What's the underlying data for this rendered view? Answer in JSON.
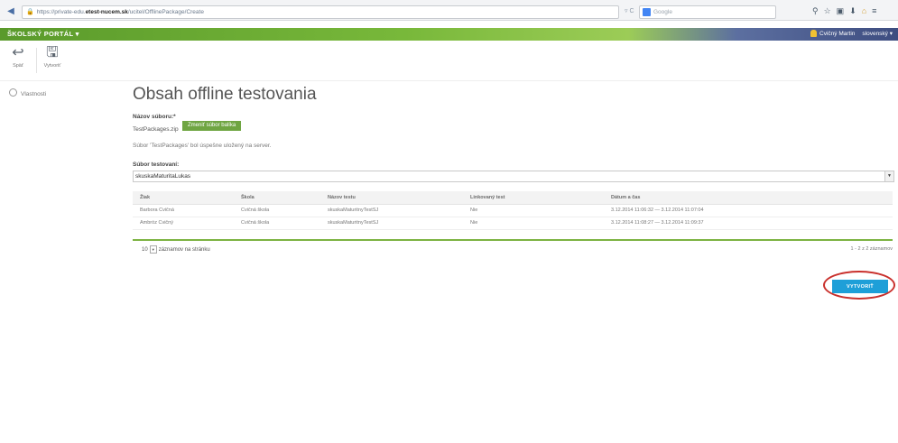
{
  "browser": {
    "url_prefix": "https://private-edu.",
    "url_domain": "etest-nucem.sk",
    "url_path": "/ucitel/OfflinePackage/Create",
    "search_placeholder": "Google",
    "reload_glyph": "▿ C"
  },
  "portal": {
    "title": "ŠKOLSKÝ PORTÁL ▾",
    "user_name": "Cvičný Martin",
    "language": "slovenský ▾"
  },
  "toolbar": {
    "back_label": "Späť",
    "create_label": "Vytvoriť"
  },
  "sidebar": {
    "item_label": "Vlastnosti"
  },
  "main": {
    "title": "Obsah offline testovania",
    "filename_label": "Názov súboru:*",
    "filename_value": "TestPackages.zip",
    "change_button": "Zmeniť súbor balíka",
    "upload_message": "Súbor 'TestPackages' bol úspešne uložený na server.",
    "test_file_label": "Súbor testovaní:",
    "test_file_value": "skuskaMaturitaLukas"
  },
  "table": {
    "columns": [
      "Žiak",
      "Škola",
      "Názov testu",
      "Linkovaný test",
      "Dátum a čas"
    ],
    "rows": [
      [
        "Barbora Cvičná",
        "Cvičná škola",
        "skuskaMaturitnyTestSJ",
        "Nie",
        "3.12.2014 11:06:32 — 3.12.2014 11:07:04"
      ],
      [
        "Ambróz Cvičný",
        "Cvičná škola",
        "skuskaMaturitnyTestSJ",
        "Nie",
        "3.12.2014 11:08:27 — 3.12.2014 11:09:37"
      ]
    ],
    "page_size": "10",
    "page_size_suffix": "záznamov na stránku",
    "summary": "1 - 2 z 2 záznamov"
  },
  "actions": {
    "create_button": "VYTVORIŤ"
  },
  "colors": {
    "portal_green": "#78b83a",
    "create_blue": "#1e9fd8",
    "highlight_red": "#c9302c"
  }
}
